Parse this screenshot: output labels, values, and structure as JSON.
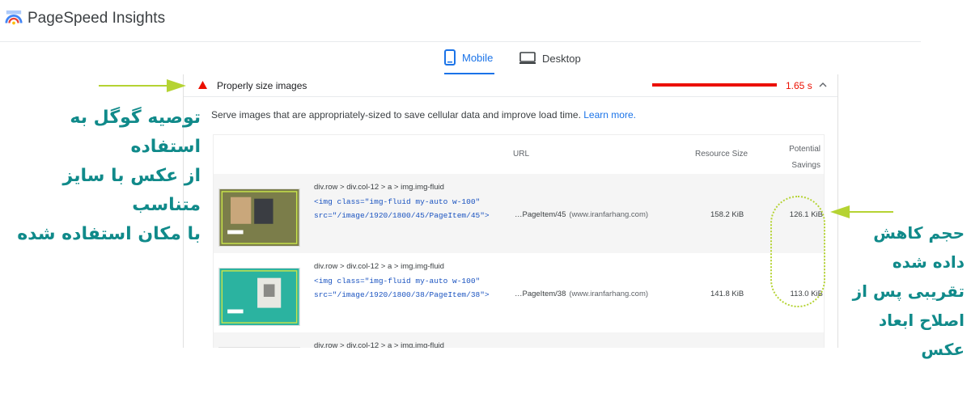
{
  "app": {
    "title": "PageSpeed Insights"
  },
  "tabs": [
    {
      "label": "Mobile",
      "active": true
    },
    {
      "label": "Desktop",
      "active": false
    }
  ],
  "audit": {
    "title": "Properly size images",
    "time": "1.65 s",
    "description": "Serve images that are appropriately-sized to save cellular data and improve load time.",
    "learn_more": "Learn more."
  },
  "table": {
    "headers": {
      "url": "URL",
      "size": "Resource Size",
      "savings_line1": "Potential",
      "savings_line2": "Savings"
    },
    "rows": [
      {
        "selector": "div.row > div.col-12 > a > img.img-fluid",
        "snippet_line1": "<img class=\"img-fluid my-auto w-100\"",
        "snippet_line2": "src=\"/image/1920/1800/45/PageItem/45\">",
        "url_path": "…PageItem/45",
        "url_host": "(www.iranfarhang.com)",
        "size": "158.2 KiB",
        "savings": "126.1 KiB"
      },
      {
        "selector": "div.row > div.col-12 > a > img.img-fluid",
        "snippet_line1": "<img class=\"img-fluid my-auto w-100\"",
        "snippet_line2": "src=\"/image/1920/1800/38/PageItem/38\">",
        "url_path": "…PageItem/38",
        "url_host": "(www.iranfarhang.com)",
        "size": "141.8 KiB",
        "savings": "113.0 KiB"
      },
      {
        "selector": "div.row > div.col-12 > a > img.img-fluid"
      }
    ]
  },
  "annotations": {
    "left_lines": [
      "توصیه گوگل به استفاده",
      "از عکس با سایز متناسب",
      "با مکان استفاده شده"
    ],
    "right_lines": [
      "حجم کاهش",
      "داده شده",
      "تقریبی پس از",
      "اصلاح ابعاد",
      "عکس"
    ]
  },
  "colors": {
    "accent": "#1a73e8",
    "fail": "#eb0f00",
    "annotation_text": "#108a8a",
    "arrow": "#b5d333"
  },
  "icons": {
    "logo": "pagespeed-logo-icon",
    "mobile": "mobile-phone-icon",
    "desktop": "desktop-monitor-icon",
    "fail": "red-triangle-icon",
    "collapse": "chevron-up-icon"
  }
}
